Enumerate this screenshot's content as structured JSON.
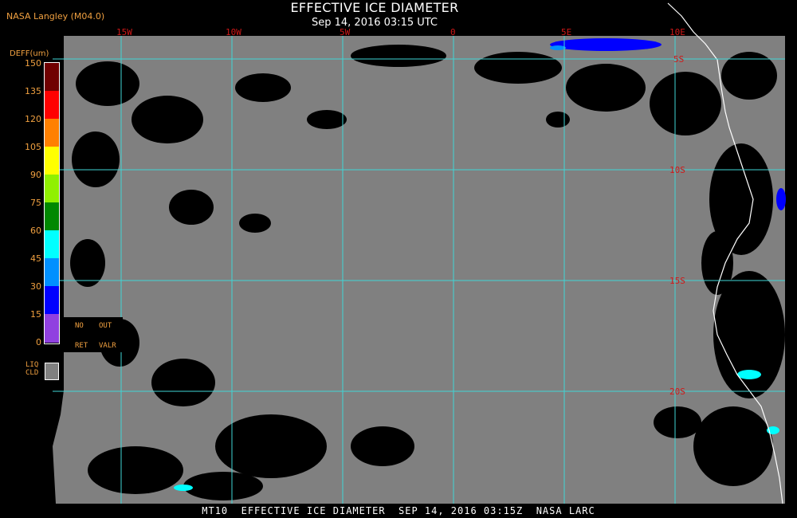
{
  "header": {
    "agency": "NASA Langley (M04.0)",
    "title": "EFFECTIVE ICE DIAMETER",
    "subtitle": "Sep 14, 2016 03:15 UTC"
  },
  "footer": {
    "caption": "MT10  EFFECTIVE ICE DIAMETER  SEP 14, 2016 03:15Z  NASA LARC"
  },
  "map": {
    "longitude_labels": [
      "15W",
      "10W",
      "5W",
      "0",
      "5E",
      "10E"
    ],
    "latitude_labels": [
      "5S",
      "10S",
      "15S",
      "20S"
    ],
    "colors": {
      "grid": "#3fd6d6",
      "liquid_cloud": "#808080",
      "clear": "#000000",
      "label": "#d01818",
      "coast": "#ffffff"
    }
  },
  "legend": {
    "title": "DEFF(um)",
    "ticks": [
      "150",
      "135",
      "120",
      "105",
      "90",
      "75",
      "60",
      "45",
      "30",
      "15",
      "0"
    ],
    "colors": [
      "#700000",
      "#ff0000",
      "#ff8000",
      "#ffff00",
      "#90f000",
      "#008800",
      "#00ffff",
      "#0090ff",
      "#0000ff",
      "#9040e0"
    ],
    "no_ret_line1": "NO",
    "no_ret_line2": "RET",
    "out_valr_line1": "OUT",
    "out_valr_line2": "VALR",
    "liq_line1": "LIQ",
    "liq_line2": "CLD"
  }
}
